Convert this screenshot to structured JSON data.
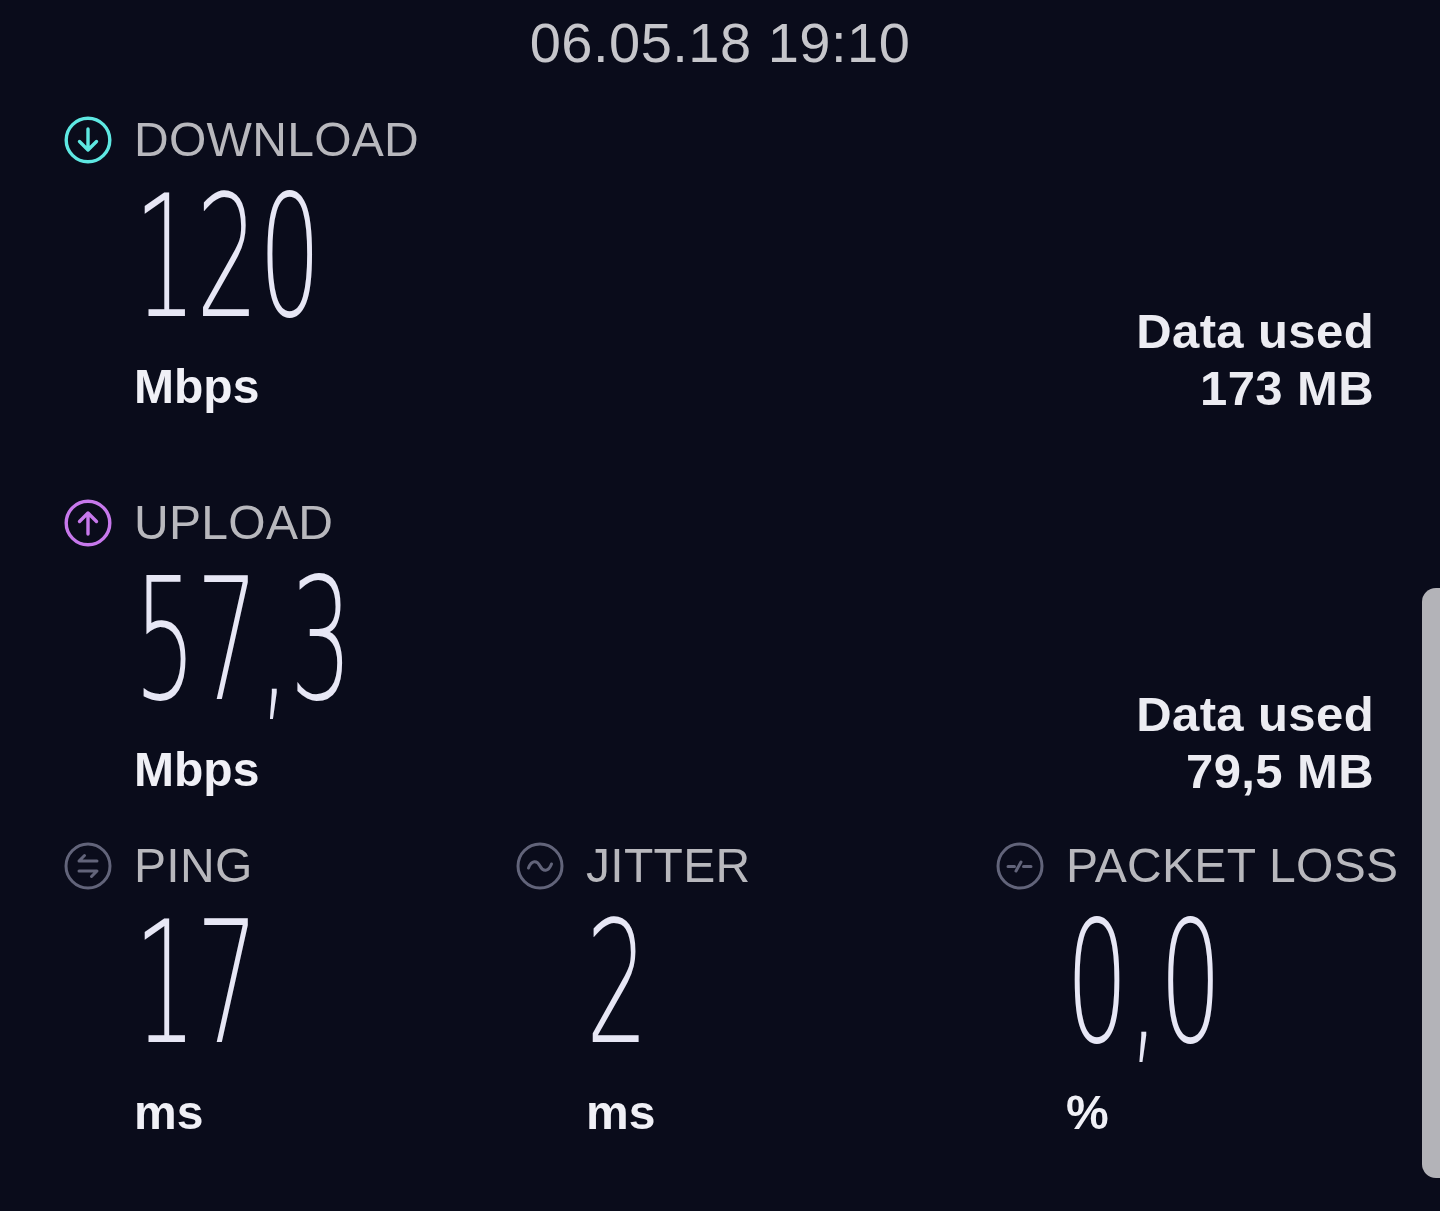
{
  "timestamp": "06.05.18 19:10",
  "results": [
    {
      "kind": "download",
      "label": "DOWNLOAD",
      "color": "#5ee8e2",
      "value": "120",
      "unit": "Mbps",
      "data_used_label": "Data used",
      "data_used": "173 MB"
    },
    {
      "kind": "upload",
      "label": "UPLOAD",
      "color": "#c778ec",
      "value": "57,3",
      "unit": "Mbps",
      "data_used_label": "Data used",
      "data_used": "79,5 MB"
    }
  ],
  "metrics": [
    {
      "kind": "ping",
      "label": "PING",
      "value": "17",
      "unit": "ms"
    },
    {
      "kind": "jitter",
      "label": "JITTER",
      "value": "2",
      "unit": "ms"
    },
    {
      "kind": "packet_loss",
      "label": "PACKET LOSS",
      "value": "0,0",
      "unit": "%"
    }
  ]
}
